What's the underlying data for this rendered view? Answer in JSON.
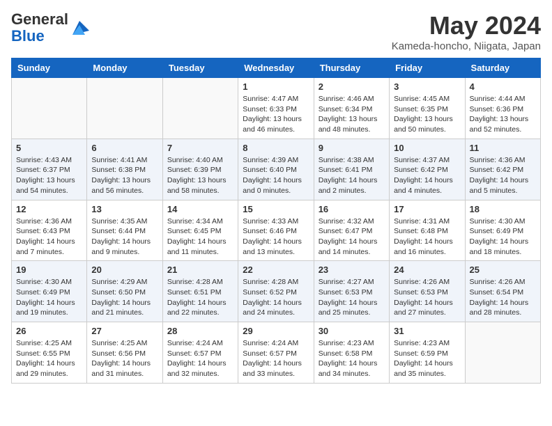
{
  "header": {
    "logo_general": "General",
    "logo_blue": "Blue",
    "month_title": "May 2024",
    "location": "Kameda-honcho, Niigata, Japan"
  },
  "days_of_week": [
    "Sunday",
    "Monday",
    "Tuesday",
    "Wednesday",
    "Thursday",
    "Friday",
    "Saturday"
  ],
  "weeks": [
    [
      {
        "day": "",
        "info": ""
      },
      {
        "day": "",
        "info": ""
      },
      {
        "day": "",
        "info": ""
      },
      {
        "day": "1",
        "info": "Sunrise: 4:47 AM\nSunset: 6:33 PM\nDaylight: 13 hours\nand 46 minutes."
      },
      {
        "day": "2",
        "info": "Sunrise: 4:46 AM\nSunset: 6:34 PM\nDaylight: 13 hours\nand 48 minutes."
      },
      {
        "day": "3",
        "info": "Sunrise: 4:45 AM\nSunset: 6:35 PM\nDaylight: 13 hours\nand 50 minutes."
      },
      {
        "day": "4",
        "info": "Sunrise: 4:44 AM\nSunset: 6:36 PM\nDaylight: 13 hours\nand 52 minutes."
      }
    ],
    [
      {
        "day": "5",
        "info": "Sunrise: 4:43 AM\nSunset: 6:37 PM\nDaylight: 13 hours\nand 54 minutes."
      },
      {
        "day": "6",
        "info": "Sunrise: 4:41 AM\nSunset: 6:38 PM\nDaylight: 13 hours\nand 56 minutes."
      },
      {
        "day": "7",
        "info": "Sunrise: 4:40 AM\nSunset: 6:39 PM\nDaylight: 13 hours\nand 58 minutes."
      },
      {
        "day": "8",
        "info": "Sunrise: 4:39 AM\nSunset: 6:40 PM\nDaylight: 14 hours\nand 0 minutes."
      },
      {
        "day": "9",
        "info": "Sunrise: 4:38 AM\nSunset: 6:41 PM\nDaylight: 14 hours\nand 2 minutes."
      },
      {
        "day": "10",
        "info": "Sunrise: 4:37 AM\nSunset: 6:42 PM\nDaylight: 14 hours\nand 4 minutes."
      },
      {
        "day": "11",
        "info": "Sunrise: 4:36 AM\nSunset: 6:42 PM\nDaylight: 14 hours\nand 5 minutes."
      }
    ],
    [
      {
        "day": "12",
        "info": "Sunrise: 4:36 AM\nSunset: 6:43 PM\nDaylight: 14 hours\nand 7 minutes."
      },
      {
        "day": "13",
        "info": "Sunrise: 4:35 AM\nSunset: 6:44 PM\nDaylight: 14 hours\nand 9 minutes."
      },
      {
        "day": "14",
        "info": "Sunrise: 4:34 AM\nSunset: 6:45 PM\nDaylight: 14 hours\nand 11 minutes."
      },
      {
        "day": "15",
        "info": "Sunrise: 4:33 AM\nSunset: 6:46 PM\nDaylight: 14 hours\nand 13 minutes."
      },
      {
        "day": "16",
        "info": "Sunrise: 4:32 AM\nSunset: 6:47 PM\nDaylight: 14 hours\nand 14 minutes."
      },
      {
        "day": "17",
        "info": "Sunrise: 4:31 AM\nSunset: 6:48 PM\nDaylight: 14 hours\nand 16 minutes."
      },
      {
        "day": "18",
        "info": "Sunrise: 4:30 AM\nSunset: 6:49 PM\nDaylight: 14 hours\nand 18 minutes."
      }
    ],
    [
      {
        "day": "19",
        "info": "Sunrise: 4:30 AM\nSunset: 6:49 PM\nDaylight: 14 hours\nand 19 minutes."
      },
      {
        "day": "20",
        "info": "Sunrise: 4:29 AM\nSunset: 6:50 PM\nDaylight: 14 hours\nand 21 minutes."
      },
      {
        "day": "21",
        "info": "Sunrise: 4:28 AM\nSunset: 6:51 PM\nDaylight: 14 hours\nand 22 minutes."
      },
      {
        "day": "22",
        "info": "Sunrise: 4:28 AM\nSunset: 6:52 PM\nDaylight: 14 hours\nand 24 minutes."
      },
      {
        "day": "23",
        "info": "Sunrise: 4:27 AM\nSunset: 6:53 PM\nDaylight: 14 hours\nand 25 minutes."
      },
      {
        "day": "24",
        "info": "Sunrise: 4:26 AM\nSunset: 6:53 PM\nDaylight: 14 hours\nand 27 minutes."
      },
      {
        "day": "25",
        "info": "Sunrise: 4:26 AM\nSunset: 6:54 PM\nDaylight: 14 hours\nand 28 minutes."
      }
    ],
    [
      {
        "day": "26",
        "info": "Sunrise: 4:25 AM\nSunset: 6:55 PM\nDaylight: 14 hours\nand 29 minutes."
      },
      {
        "day": "27",
        "info": "Sunrise: 4:25 AM\nSunset: 6:56 PM\nDaylight: 14 hours\nand 31 minutes."
      },
      {
        "day": "28",
        "info": "Sunrise: 4:24 AM\nSunset: 6:57 PM\nDaylight: 14 hours\nand 32 minutes."
      },
      {
        "day": "29",
        "info": "Sunrise: 4:24 AM\nSunset: 6:57 PM\nDaylight: 14 hours\nand 33 minutes."
      },
      {
        "day": "30",
        "info": "Sunrise: 4:23 AM\nSunset: 6:58 PM\nDaylight: 14 hours\nand 34 minutes."
      },
      {
        "day": "31",
        "info": "Sunrise: 4:23 AM\nSunset: 6:59 PM\nDaylight: 14 hours\nand 35 minutes."
      },
      {
        "day": "",
        "info": ""
      }
    ]
  ]
}
